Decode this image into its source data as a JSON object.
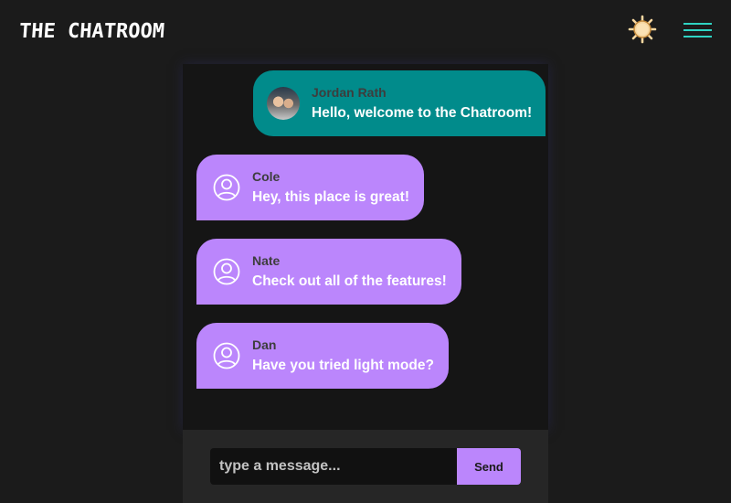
{
  "header": {
    "title": "THE CHATROOM",
    "theme_icon": "sun-icon",
    "menu_icon": "hamburger-menu-icon"
  },
  "messages": [
    {
      "name": "Jordan Rath",
      "text": "Hello, welcome to the Chatroom!",
      "avatar": "user-photo"
    },
    {
      "name": "Cole",
      "text": "Hey, this place is great!",
      "avatar": "user-circle-icon"
    },
    {
      "name": "Nate",
      "text": "Check out all of the features!",
      "avatar": "user-circle-icon"
    },
    {
      "name": "Dan",
      "text": "Have you tried light mode?",
      "avatar": "user-circle-icon"
    }
  ],
  "composer": {
    "placeholder": "type a message...",
    "send_label": "Send"
  },
  "colors": {
    "background": "#1b1b1b",
    "panel": "#151515",
    "self_bubble": "#018b8b",
    "other_bubble": "#bb86fc",
    "accent": "#2fd3c3",
    "sun": "#f7d7a0"
  }
}
